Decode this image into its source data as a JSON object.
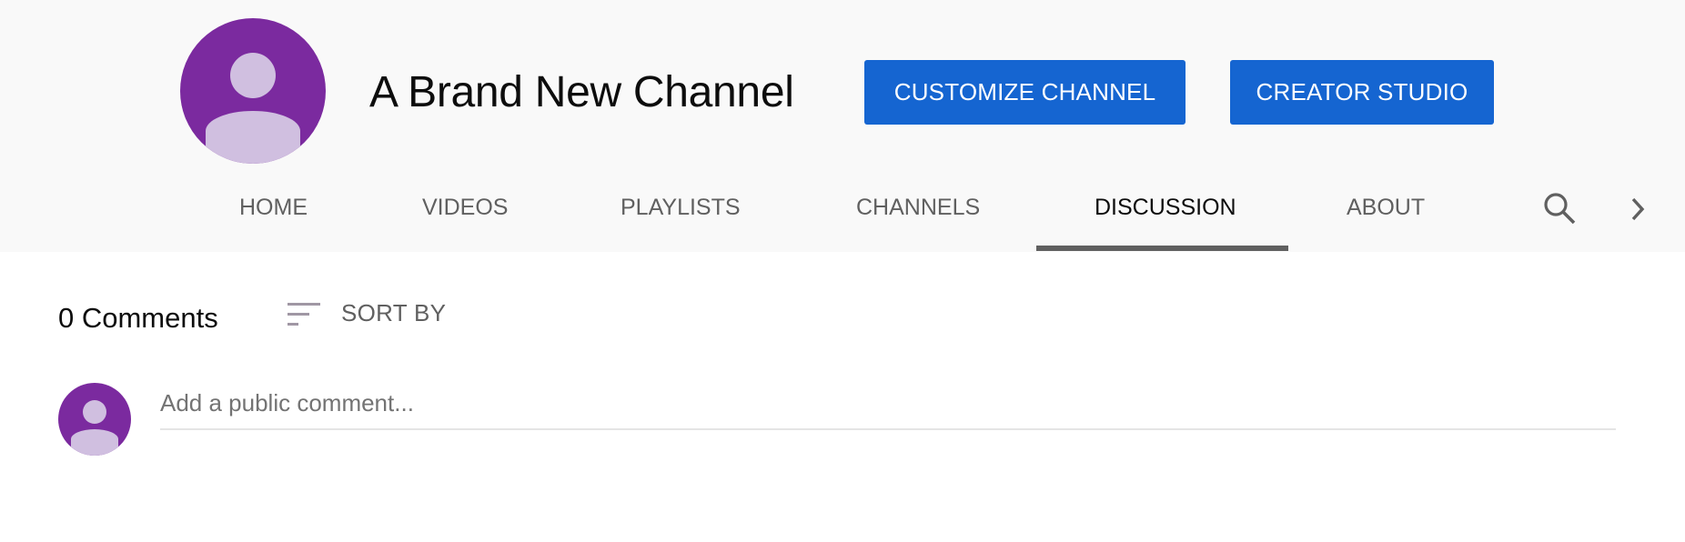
{
  "channel": {
    "title": "A Brand New Channel",
    "avatar_icon": "default-user-avatar",
    "colors": {
      "avatar_background": "#7b2a9f",
      "avatar_figure": "#d0bfe0",
      "button_primary": "#1565d1"
    }
  },
  "header_buttons": {
    "customize_label": "CUSTOMIZE CHANNEL",
    "studio_label": "CREATOR STUDIO"
  },
  "tabs": [
    {
      "label": "HOME",
      "active": false
    },
    {
      "label": "VIDEOS",
      "active": false
    },
    {
      "label": "PLAYLISTS",
      "active": false
    },
    {
      "label": "CHANNELS",
      "active": false
    },
    {
      "label": "DISCUSSION",
      "active": true
    },
    {
      "label": "ABOUT",
      "active": false
    }
  ],
  "tab_icons": {
    "search": "search-icon",
    "next": "chevron-right-icon"
  },
  "discussion": {
    "comments_count_label": "0 Comments",
    "sort_label": "SORT BY",
    "sort_icon": "sort-icon",
    "comment_placeholder": "Add a public comment...",
    "comment_value": ""
  }
}
